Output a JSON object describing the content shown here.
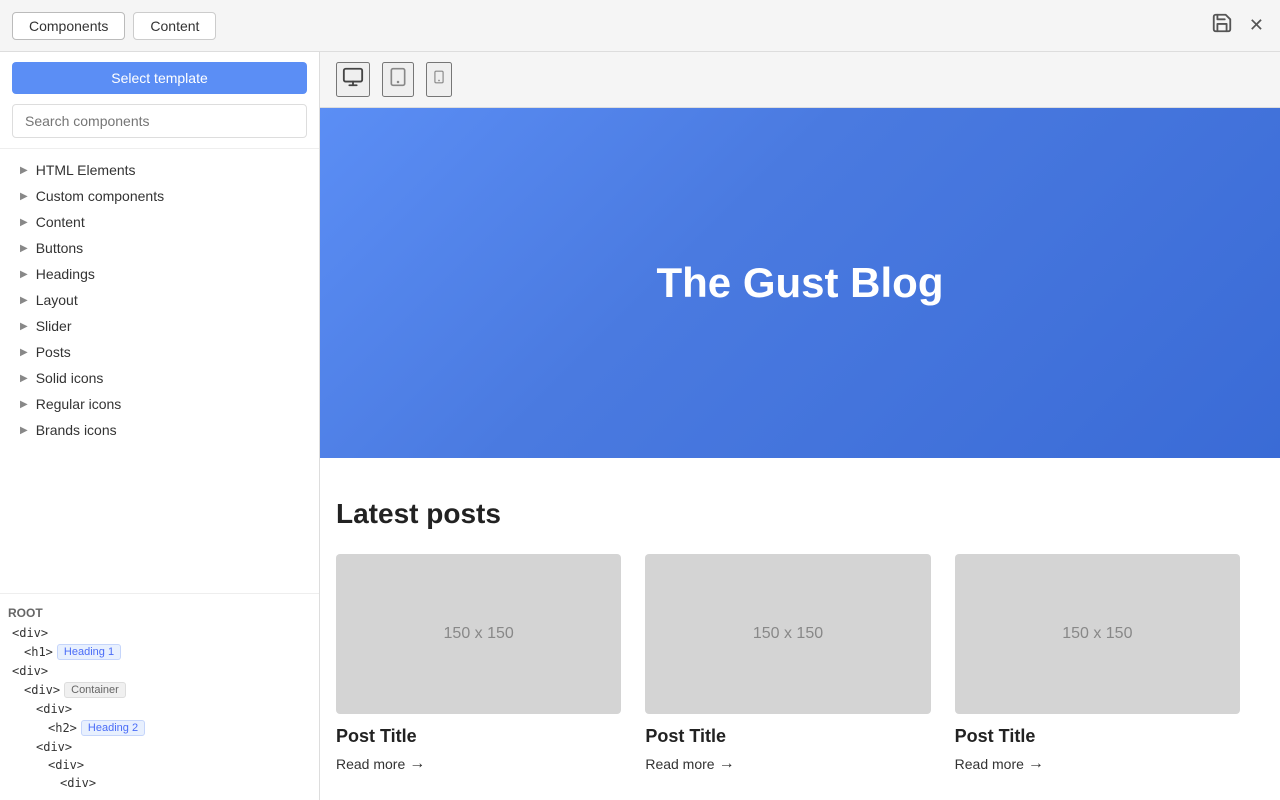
{
  "topbar": {
    "tabs": [
      {
        "id": "components",
        "label": "Components",
        "active": true
      },
      {
        "id": "content",
        "label": "Content",
        "active": false
      }
    ],
    "icons": {
      "save": "💾",
      "close": "✕"
    }
  },
  "sidebar": {
    "select_template_label": "Select template",
    "search_placeholder": "Search components",
    "tree_items": [
      {
        "id": "html-elements",
        "label": "HTML Elements"
      },
      {
        "id": "custom-components",
        "label": "Custom components"
      },
      {
        "id": "content",
        "label": "Content"
      },
      {
        "id": "buttons",
        "label": "Buttons"
      },
      {
        "id": "headings",
        "label": "Headings"
      },
      {
        "id": "layout",
        "label": "Layout"
      },
      {
        "id": "slider",
        "label": "Slider"
      },
      {
        "id": "posts",
        "label": "Posts"
      },
      {
        "id": "solid-icons",
        "label": "Solid icons"
      },
      {
        "id": "regular-icons",
        "label": "Regular icons"
      },
      {
        "id": "brands-icons",
        "label": "Brands icons"
      }
    ],
    "dom": {
      "root_label": "ROOT",
      "lines": [
        {
          "tag": "<div>",
          "indent": 1,
          "badge": null,
          "badge_type": null
        },
        {
          "tag": "<h1>",
          "indent": 2,
          "badge": "Heading 1",
          "badge_type": "blue"
        },
        {
          "tag": "<div>",
          "indent": 1,
          "badge": null,
          "badge_type": null
        },
        {
          "tag": "<div>",
          "indent": 2,
          "badge": "Container",
          "badge_type": "gray"
        },
        {
          "tag": "<div>",
          "indent": 3,
          "badge": null,
          "badge_type": null
        },
        {
          "tag": "<h2>",
          "indent": 4,
          "badge": "Heading 2",
          "badge_type": "blue"
        },
        {
          "tag": "<div>",
          "indent": 3,
          "badge": null,
          "badge_type": null
        },
        {
          "tag": "<div>",
          "indent": 4,
          "badge": null,
          "badge_type": null
        },
        {
          "tag": "<div>",
          "indent": 5,
          "badge": null,
          "badge_type": null
        }
      ]
    }
  },
  "viewport": {
    "icons": [
      "🖥",
      "⬛",
      "📱"
    ]
  },
  "preview": {
    "hero": {
      "title": "The Gust Blog"
    },
    "latest_posts": {
      "section_title": "Latest posts",
      "image_placeholder": "150 x 150",
      "posts": [
        {
          "title": "Post Title",
          "read_more": "Read more"
        },
        {
          "title": "Post Title",
          "read_more": "Read more"
        },
        {
          "title": "Post Title",
          "read_more": "Read more"
        }
      ]
    }
  }
}
